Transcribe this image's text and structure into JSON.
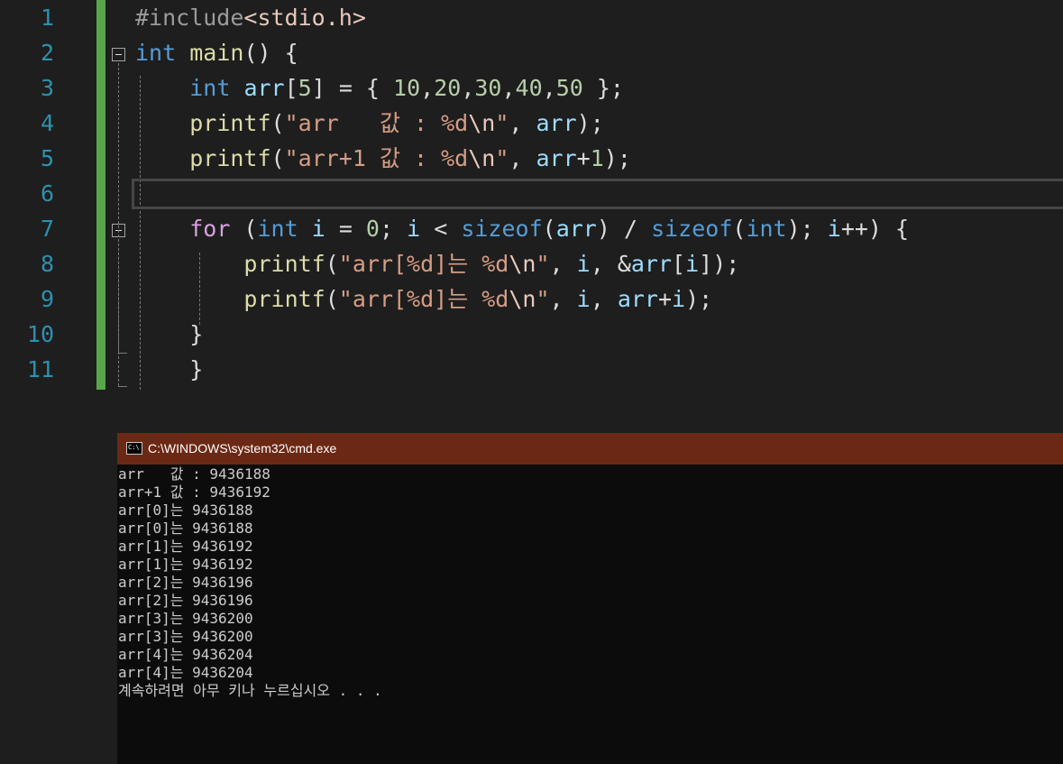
{
  "editor": {
    "line_numbers": [
      "1",
      "2",
      "3",
      "4",
      "5",
      "6",
      "7",
      "8",
      "9",
      "10",
      "11"
    ],
    "lines": [
      [
        {
          "c": "pp",
          "t": "#include"
        },
        {
          "c": "inc",
          "t": "<stdio.h>"
        }
      ],
      [
        {
          "c": "kw",
          "t": "int"
        },
        {
          "c": "",
          "t": " "
        },
        {
          "c": "fn",
          "t": "main"
        },
        {
          "c": "",
          "t": "() {"
        }
      ],
      [
        {
          "c": "",
          "t": "    "
        },
        {
          "c": "kw",
          "t": "int"
        },
        {
          "c": "",
          "t": " "
        },
        {
          "c": "var",
          "t": "arr"
        },
        {
          "c": "",
          "t": "["
        },
        {
          "c": "num",
          "t": "5"
        },
        {
          "c": "",
          "t": "] = { "
        },
        {
          "c": "num",
          "t": "10"
        },
        {
          "c": "",
          "t": ","
        },
        {
          "c": "num",
          "t": "20"
        },
        {
          "c": "",
          "t": ","
        },
        {
          "c": "num",
          "t": "30"
        },
        {
          "c": "",
          "t": ","
        },
        {
          "c": "num",
          "t": "40"
        },
        {
          "c": "",
          "t": ","
        },
        {
          "c": "num",
          "t": "50"
        },
        {
          "c": "",
          "t": " };"
        }
      ],
      [
        {
          "c": "",
          "t": "    "
        },
        {
          "c": "fn",
          "t": "printf"
        },
        {
          "c": "",
          "t": "("
        },
        {
          "c": "str",
          "t": "\"arr   값 : %d"
        },
        {
          "c": "esc",
          "t": "\\n"
        },
        {
          "c": "str",
          "t": "\""
        },
        {
          "c": "",
          "t": ", "
        },
        {
          "c": "var",
          "t": "arr"
        },
        {
          "c": "",
          "t": ");"
        }
      ],
      [
        {
          "c": "",
          "t": "    "
        },
        {
          "c": "fn",
          "t": "printf"
        },
        {
          "c": "",
          "t": "("
        },
        {
          "c": "str",
          "t": "\"arr+1 값 : %d"
        },
        {
          "c": "esc",
          "t": "\\n"
        },
        {
          "c": "str",
          "t": "\""
        },
        {
          "c": "",
          "t": ", "
        },
        {
          "c": "var",
          "t": "arr"
        },
        {
          "c": "",
          "t": "+"
        },
        {
          "c": "num",
          "t": "1"
        },
        {
          "c": "",
          "t": ");"
        }
      ],
      [],
      [
        {
          "c": "",
          "t": "    "
        },
        {
          "c": "kwf",
          "t": "for"
        },
        {
          "c": "",
          "t": " ("
        },
        {
          "c": "kw",
          "t": "int"
        },
        {
          "c": "",
          "t": " "
        },
        {
          "c": "var",
          "t": "i"
        },
        {
          "c": "",
          "t": " = "
        },
        {
          "c": "num",
          "t": "0"
        },
        {
          "c": "",
          "t": "; "
        },
        {
          "c": "var",
          "t": "i"
        },
        {
          "c": "",
          "t": " < "
        },
        {
          "c": "kw",
          "t": "sizeof"
        },
        {
          "c": "",
          "t": "("
        },
        {
          "c": "var",
          "t": "arr"
        },
        {
          "c": "",
          "t": ") / "
        },
        {
          "c": "kw",
          "t": "sizeof"
        },
        {
          "c": "",
          "t": "("
        },
        {
          "c": "kw",
          "t": "int"
        },
        {
          "c": "",
          "t": "); "
        },
        {
          "c": "var",
          "t": "i"
        },
        {
          "c": "",
          "t": "++) {"
        }
      ],
      [
        {
          "c": "",
          "t": "        "
        },
        {
          "c": "fn",
          "t": "printf"
        },
        {
          "c": "",
          "t": "("
        },
        {
          "c": "str",
          "t": "\"arr[%d]는 %d"
        },
        {
          "c": "esc",
          "t": "\\n"
        },
        {
          "c": "str",
          "t": "\""
        },
        {
          "c": "",
          "t": ", "
        },
        {
          "c": "var",
          "t": "i"
        },
        {
          "c": "",
          "t": ", &"
        },
        {
          "c": "var",
          "t": "arr"
        },
        {
          "c": "",
          "t": "["
        },
        {
          "c": "var",
          "t": "i"
        },
        {
          "c": "",
          "t": "]);"
        }
      ],
      [
        {
          "c": "",
          "t": "        "
        },
        {
          "c": "fn",
          "t": "printf"
        },
        {
          "c": "",
          "t": "("
        },
        {
          "c": "str",
          "t": "\"arr[%d]는 %d"
        },
        {
          "c": "esc",
          "t": "\\n"
        },
        {
          "c": "str",
          "t": "\""
        },
        {
          "c": "",
          "t": ", "
        },
        {
          "c": "var",
          "t": "i"
        },
        {
          "c": "",
          "t": ", "
        },
        {
          "c": "var",
          "t": "arr"
        },
        {
          "c": "",
          "t": "+"
        },
        {
          "c": "var",
          "t": "i"
        },
        {
          "c": "",
          "t": ");"
        }
      ],
      [
        {
          "c": "",
          "t": "    }"
        }
      ],
      [
        {
          "c": "",
          "t": "    }"
        }
      ]
    ]
  },
  "console": {
    "title": "C:\\WINDOWS\\system32\\cmd.exe",
    "lines": [
      "arr   값 : 9436188",
      "arr+1 값 : 9436192",
      "arr[0]는 9436188",
      "arr[0]는 9436188",
      "arr[1]는 9436192",
      "arr[1]는 9436192",
      "arr[2]는 9436196",
      "arr[2]는 9436196",
      "arr[3]는 9436200",
      "arr[3]는 9436200",
      "arr[4]는 9436204",
      "arr[4]는 9436204",
      "계속하려면 아무 키나 누르십시오 . . ."
    ]
  },
  "colors": {
    "editor_bg": "#1e1e1e",
    "line_number": "#2b91af",
    "change_bar": "#57a64a",
    "console_title_bg": "#6b2915",
    "console_bg": "#0c0c0c"
  }
}
